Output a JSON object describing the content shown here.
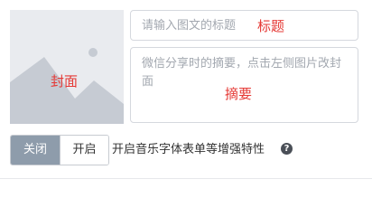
{
  "cover": {
    "label": "封面",
    "icon": "image-placeholder-icon",
    "label_color": "#e53935"
  },
  "title_field": {
    "placeholder": "请输入图文的标题",
    "value": "",
    "annotation": "标题"
  },
  "summary_field": {
    "placeholder": "微信分享时的摘要，点击左侧图片改封面",
    "value": "",
    "annotation": "摘要"
  },
  "feature_toggle": {
    "off_label": "关闭",
    "on_label": "开启",
    "selected": "关闭",
    "description": "开启音乐字体表单等增强特性",
    "help_icon": "question-circle-icon",
    "active_color": "#8e9cab"
  }
}
